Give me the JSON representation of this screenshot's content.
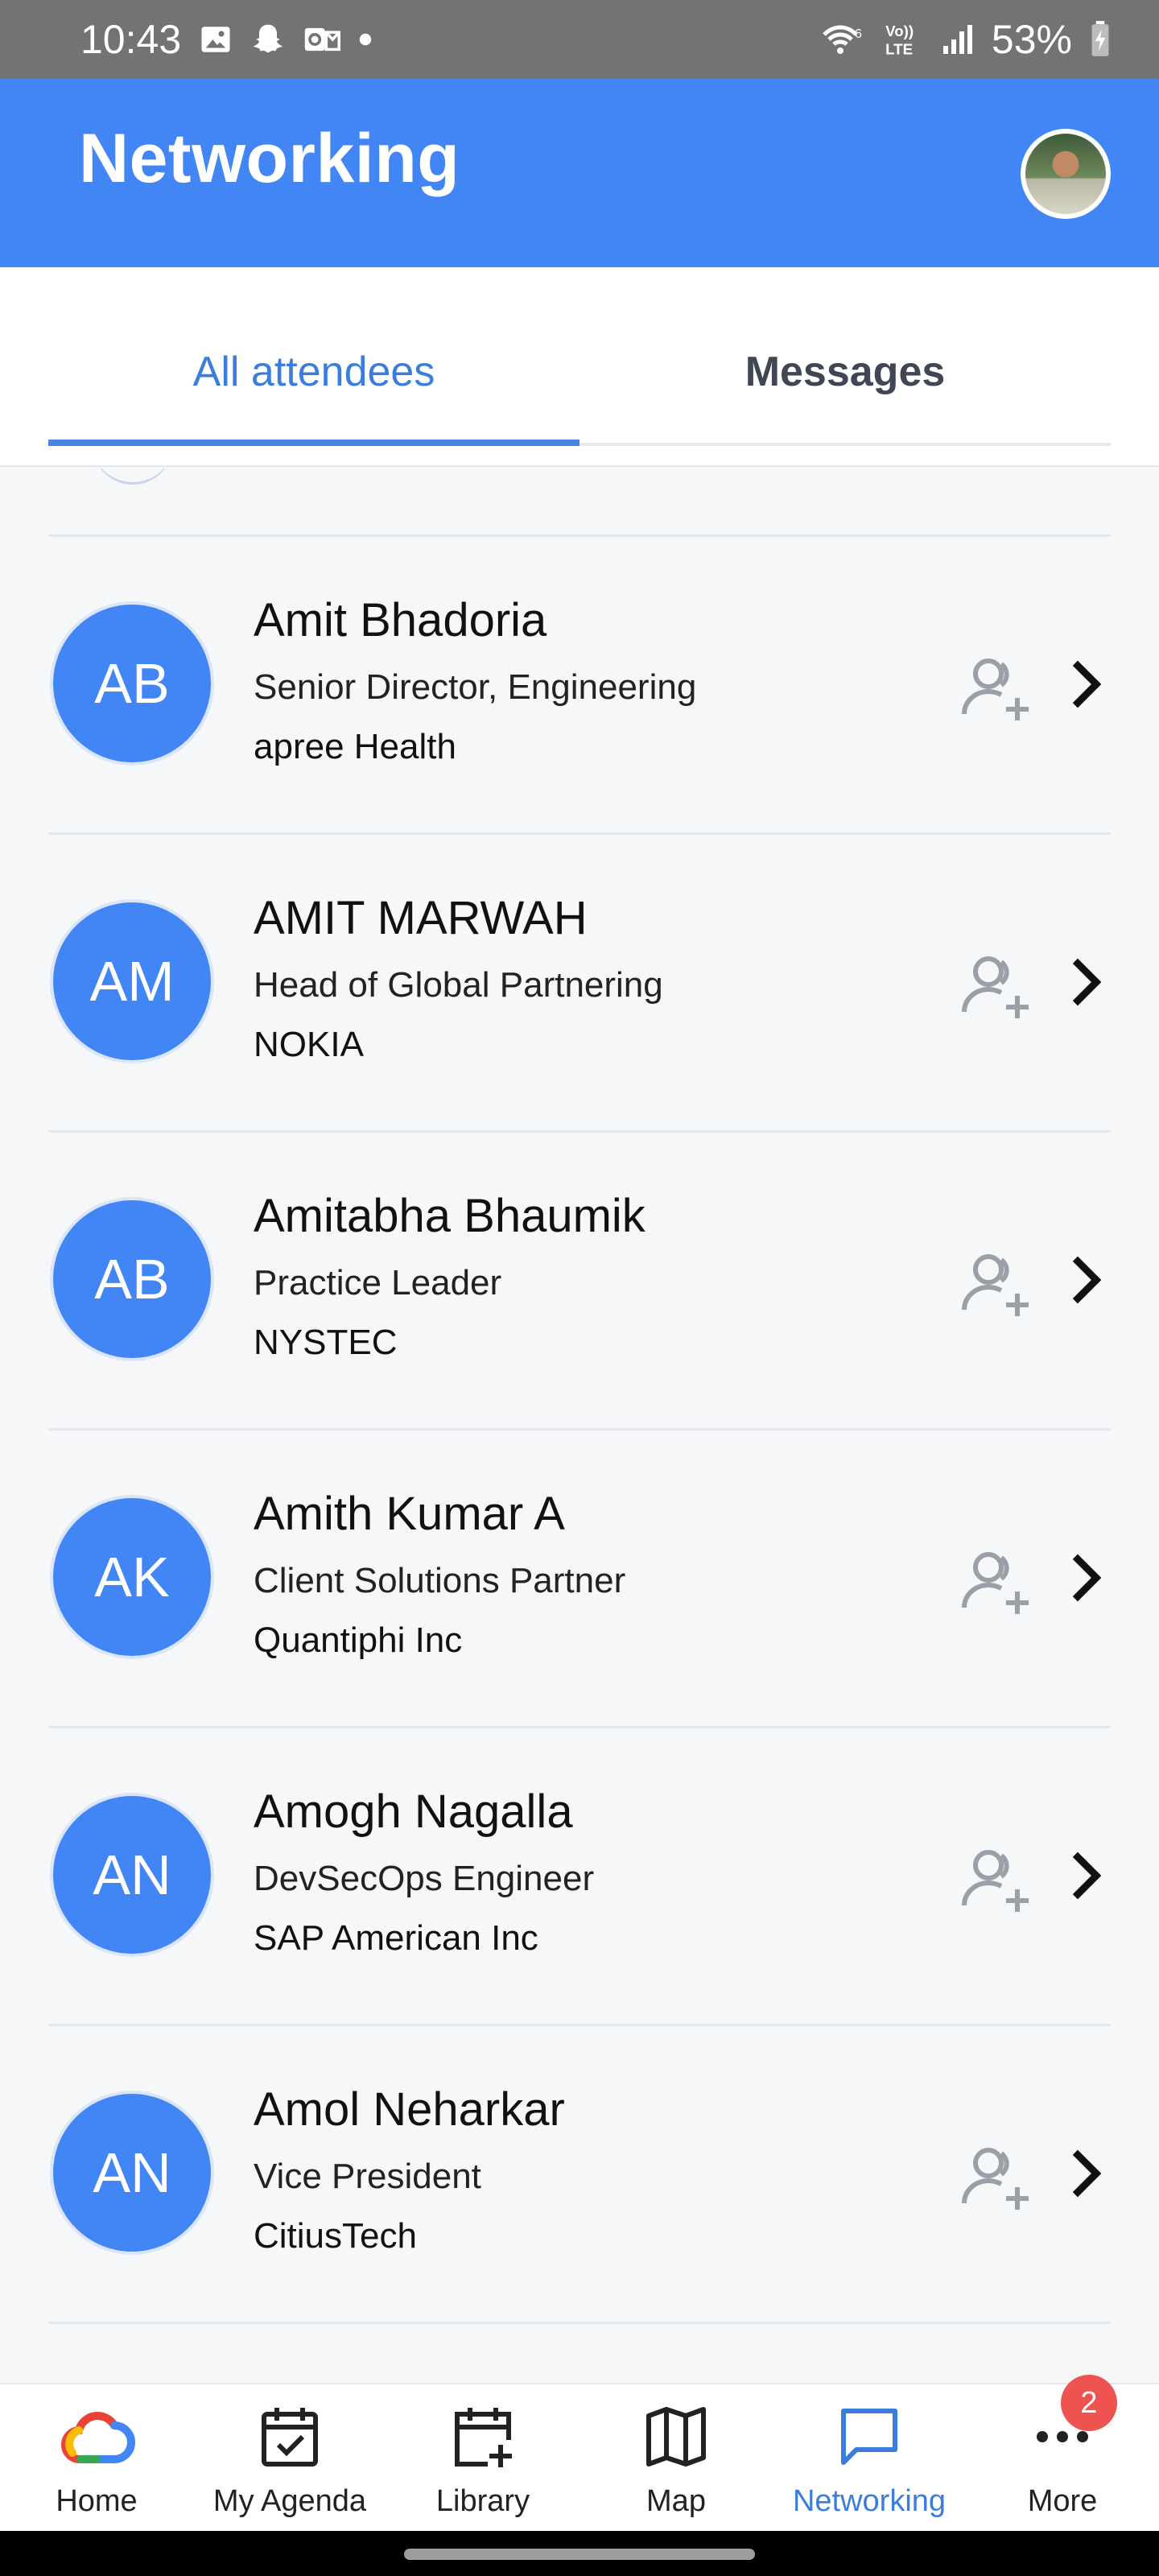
{
  "status_bar": {
    "time": "10:43",
    "battery": "53%",
    "left_icons": [
      "gallery-icon",
      "snapchat-icon",
      "outlook-icon",
      "dot-icon"
    ],
    "right_icons": [
      "wifi-6-icon",
      "volte-icon",
      "signal-icon",
      "battery-charging-icon"
    ]
  },
  "header": {
    "title": "Networking",
    "background": "#4285f4"
  },
  "tabs": {
    "active": "All attendees",
    "inactive": "Messages"
  },
  "attendees": [
    {
      "initials": "AB",
      "name": "Amit Bhadoria",
      "title": "Senior Director, Engineering",
      "company": "apree Health"
    },
    {
      "initials": "AM",
      "name": "AMIT MARWAH",
      "title": "Head of Global Partnering",
      "company": "NOKIA"
    },
    {
      "initials": "AB",
      "name": "Amitabha Bhaumik",
      "title": "Practice Leader",
      "company": "NYSTEC"
    },
    {
      "initials": "AK",
      "name": "Amith Kumar A",
      "title": "Client Solutions Partner",
      "company": "Quantiphi Inc"
    },
    {
      "initials": "AN",
      "name": "Amogh Nagalla",
      "title": "DevSecOps Engineer",
      "company": "SAP American Inc"
    },
    {
      "initials": "AN",
      "name": "Amol Neharkar",
      "title": "Vice President",
      "company": "CitiusTech"
    }
  ],
  "bottom_nav": [
    {
      "label": "Home",
      "icon": "google-cloud-icon"
    },
    {
      "label": "My Agenda",
      "icon": "calendar-check-icon"
    },
    {
      "label": "Library",
      "icon": "calendar-plus-icon"
    },
    {
      "label": "Map",
      "icon": "map-icon"
    },
    {
      "label": "Networking",
      "icon": "chat-icon",
      "active": true
    },
    {
      "label": "More",
      "icon": "more-icon",
      "badge": "2"
    }
  ],
  "colors": {
    "accent": "#4285f4",
    "active_tab": "#3b7ddd",
    "badge": "#ef5350"
  }
}
